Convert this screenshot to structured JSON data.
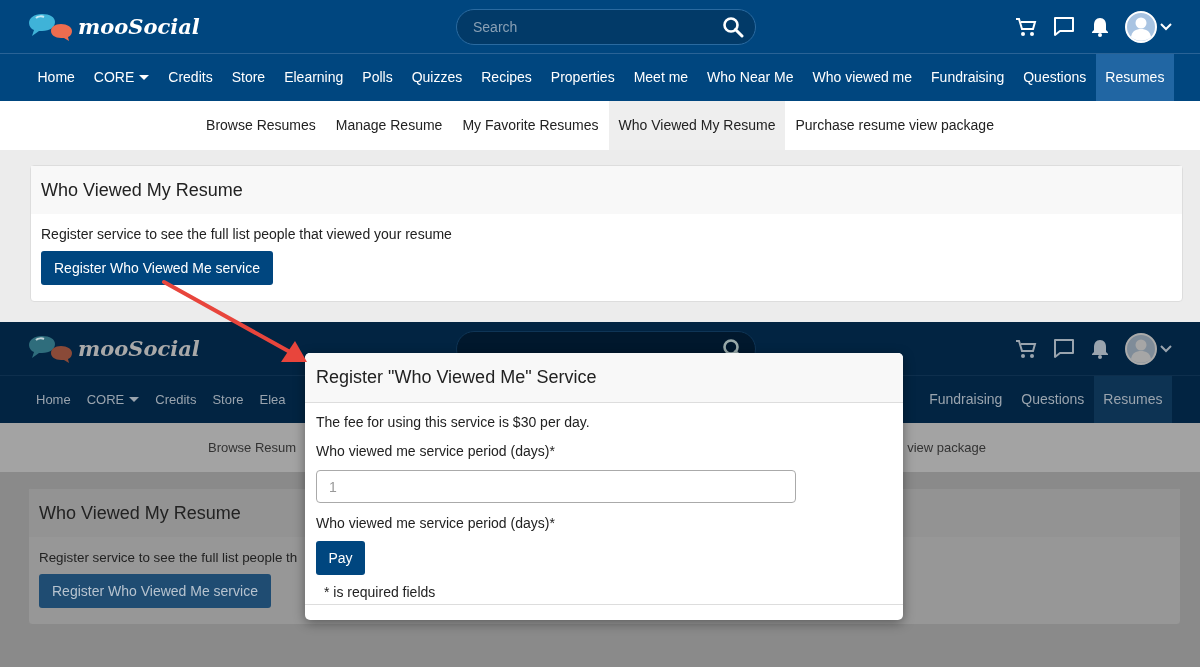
{
  "screens": [
    {
      "kind": "normal",
      "header": {
        "logo": "mooSocial",
        "search": {
          "placeholder": "Search"
        }
      },
      "nav": [
        {
          "label": "Home",
          "selected": false,
          "has_menu": false
        },
        {
          "label": "CORE",
          "selected": false,
          "has_menu": true
        },
        {
          "label": "Credits",
          "selected": false,
          "has_menu": false
        },
        {
          "label": "Store",
          "selected": false,
          "has_menu": false
        },
        {
          "label": "Elearning",
          "selected": false,
          "has_menu": false
        },
        {
          "label": "Polls",
          "selected": false,
          "has_menu": false
        },
        {
          "label": "Quizzes",
          "selected": false,
          "has_menu": false
        },
        {
          "label": "Recipes",
          "selected": false,
          "has_menu": false
        },
        {
          "label": "Properties",
          "selected": false,
          "has_menu": false
        },
        {
          "label": "Meet me",
          "selected": false,
          "has_menu": false
        },
        {
          "label": "Who Near Me",
          "selected": false,
          "has_menu": false
        },
        {
          "label": "Who viewed me",
          "selected": false,
          "has_menu": false
        },
        {
          "label": "Fundraising",
          "selected": false,
          "has_menu": false
        },
        {
          "label": "Questions",
          "selected": false,
          "has_menu": false
        },
        {
          "label": "Resumes",
          "selected": true,
          "has_menu": false
        }
      ],
      "subnav": [
        {
          "label": "Browse Resumes",
          "selected": false
        },
        {
          "label": "Manage Resume",
          "selected": false
        },
        {
          "label": "My Favorite Resumes",
          "selected": false
        },
        {
          "label": "Who Viewed My Resume",
          "selected": true
        },
        {
          "label": "Purchase resume view package",
          "selected": false
        }
      ],
      "card": {
        "title": "Who Viewed My Resume",
        "text": "Register service to see the full list people that viewed your resume",
        "button": "Register Who Viewed Me service"
      }
    },
    {
      "kind": "dimmed",
      "header": {
        "logo": "mooSocial"
      },
      "nav_left": [
        {
          "label": "Home",
          "selected": false,
          "has_menu": false
        },
        {
          "label": "CORE",
          "selected": false,
          "has_menu": true
        },
        {
          "label": "Credits",
          "selected": false,
          "has_menu": false
        },
        {
          "label": "Store",
          "selected": false,
          "has_menu": false
        },
        {
          "label": "Elea",
          "selected": false,
          "has_menu": false
        }
      ],
      "nav_right": [
        {
          "label": "Fundraising",
          "selected": false,
          "has_menu": false
        },
        {
          "label": "Questions",
          "selected": false,
          "has_menu": false
        },
        {
          "label": "Resumes",
          "selected": true,
          "has_menu": false
        }
      ],
      "subnav_left": [
        {
          "label": "Browse Resum",
          "selected": false
        }
      ],
      "subnav_right": [
        {
          "label": "view package",
          "selected": false
        }
      ],
      "card": {
        "title": "Who Viewed My Resume",
        "text": "Register service to see the full list people th",
        "button": "Register Who Viewed Me service"
      }
    }
  ],
  "modal": {
    "title": "Register \"Who Viewed Me\" Service",
    "text": "The fee for using this service is $30 per day.",
    "field_label": "Who viewed me service period (days)*",
    "input": {
      "placeholder": "1"
    },
    "second_label": "Who viewed me service period (days)*",
    "button": "Pay",
    "note": "* is required fields"
  }
}
